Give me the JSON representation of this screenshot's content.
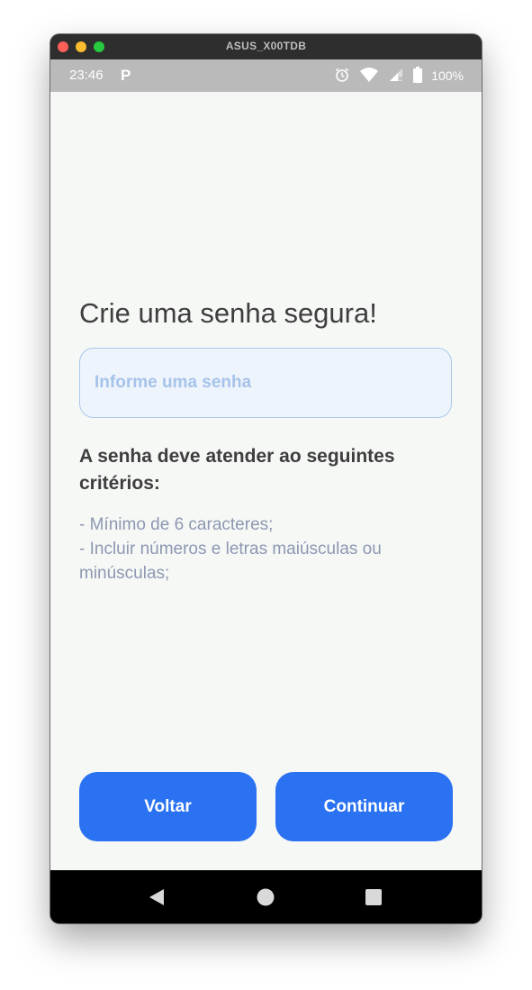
{
  "window": {
    "title": "ASUS_X00TDB"
  },
  "status_bar": {
    "time": "23:46",
    "app_icon": "P",
    "battery": "100%",
    "icons": [
      "alarm-icon",
      "wifi-icon",
      "signal-icon",
      "battery-icon"
    ]
  },
  "screen": {
    "heading": "Crie uma senha segura!",
    "password_placeholder": "Informe uma senha",
    "password_value": "",
    "criteria_title": "A senha deve atender ao seguintes critérios:",
    "criteria": [
      "- Mínimo de 6 caracteres;",
      "- Incluir números e letras maiúsculas ou minúsculas;"
    ],
    "back_label": "Voltar",
    "continue_label": "Continuar"
  },
  "nav_bar": {
    "icons": [
      "back-triangle-icon",
      "home-circle-icon",
      "recents-square-icon"
    ]
  },
  "colors": {
    "accent": "#2a72f2",
    "status_bar": "#b9bab9",
    "background": "#f6f8f6",
    "input_border": "#aac8ec",
    "criteria_text": "#8d98b1"
  }
}
